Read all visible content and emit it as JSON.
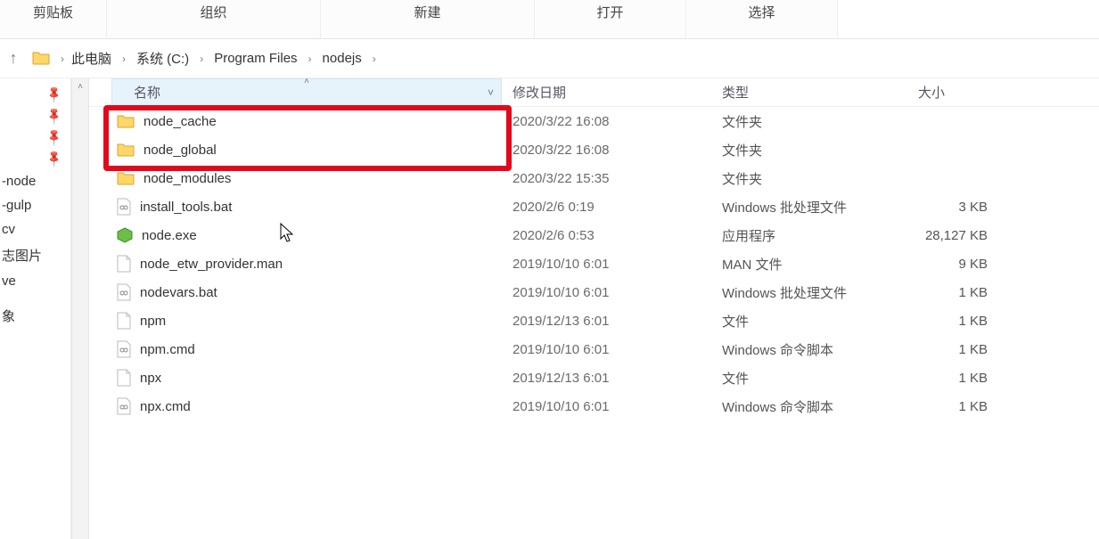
{
  "ribbon": {
    "tabs": [
      "剪贴板",
      "组织",
      "新建",
      "打开",
      "选择"
    ]
  },
  "breadcrumb": [
    "此电脑",
    "系统 (C:)",
    "Program Files",
    "nodejs"
  ],
  "sidebar": {
    "pinned_count": 4,
    "items": [
      "-node",
      "-gulp",
      "cv",
      "志图片",
      "ve",
      "",
      "象"
    ]
  },
  "columns": {
    "name": "名称",
    "date": "修改日期",
    "type": "类型",
    "size": "大小"
  },
  "files": [
    {
      "icon": "folder",
      "name": "node_cache",
      "date": "2020/3/22 16:08",
      "type": "文件夹",
      "size": ""
    },
    {
      "icon": "folder",
      "name": "node_global",
      "date": "2020/3/22 16:08",
      "type": "文件夹",
      "size": ""
    },
    {
      "icon": "folder",
      "name": "node_modules",
      "date": "2020/3/22 15:35",
      "type": "文件夹",
      "size": ""
    },
    {
      "icon": "bat",
      "name": "install_tools.bat",
      "date": "2020/2/6 0:19",
      "type": "Windows 批处理文件",
      "size": "3 KB"
    },
    {
      "icon": "exe",
      "name": "node.exe",
      "date": "2020/2/6 0:53",
      "type": "应用程序",
      "size": "28,127 KB"
    },
    {
      "icon": "file",
      "name": "node_etw_provider.man",
      "date": "2019/10/10 6:01",
      "type": "MAN 文件",
      "size": "9 KB"
    },
    {
      "icon": "bat",
      "name": "nodevars.bat",
      "date": "2019/10/10 6:01",
      "type": "Windows 批处理文件",
      "size": "1 KB"
    },
    {
      "icon": "file",
      "name": "npm",
      "date": "2019/12/13 6:01",
      "type": "文件",
      "size": "1 KB"
    },
    {
      "icon": "cmd",
      "name": "npm.cmd",
      "date": "2019/10/10 6:01",
      "type": "Windows 命令脚本",
      "size": "1 KB"
    },
    {
      "icon": "file",
      "name": "npx",
      "date": "2019/12/13 6:01",
      "type": "文件",
      "size": "1 KB"
    },
    {
      "icon": "cmd",
      "name": "npx.cmd",
      "date": "2019/10/10 6:01",
      "type": "Windows 命令脚本",
      "size": "1 KB"
    }
  ],
  "highlight_rows": [
    0,
    1
  ]
}
